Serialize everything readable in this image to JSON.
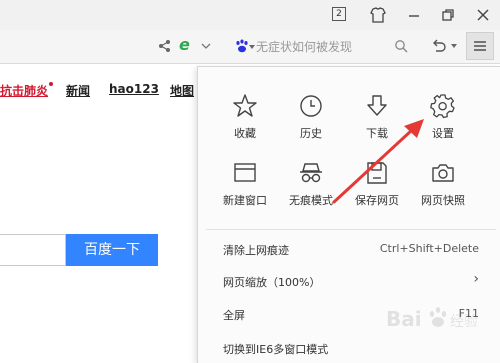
{
  "titlebar": {
    "tab_count": "2",
    "icons": [
      "shirt-icon",
      "minimize-icon",
      "restore-icon",
      "close-icon"
    ]
  },
  "toolbar": {
    "icons": [
      "share-icon",
      "ie-compat-icon",
      "chevron-down-icon",
      "baidu-paw-icon",
      "search-icon",
      "undo-icon",
      "menu-icon"
    ],
    "search_placeholder": "无症状如何被发现"
  },
  "page": {
    "nav_links": [
      "抗击肺炎",
      "新闻",
      "hao123",
      "地图"
    ],
    "search_button": "百度一下"
  },
  "menu": {
    "grid": [
      {
        "label": "收藏",
        "icon": "star-icon"
      },
      {
        "label": "历史",
        "icon": "clock-icon"
      },
      {
        "label": "下载",
        "icon": "download-icon"
      },
      {
        "label": "设置",
        "icon": "gear-icon"
      },
      {
        "label": "新建窗口",
        "icon": "new-window-icon"
      },
      {
        "label": "无痕模式",
        "icon": "incognito-icon"
      },
      {
        "label": "保存网页",
        "icon": "save-icon"
      },
      {
        "label": "网页快照",
        "icon": "camera-icon"
      }
    ],
    "rows": [
      {
        "label": "清除上网痕迹",
        "right": "Ctrl+Shift+Delete"
      },
      {
        "label": "网页缩放（100%）",
        "right": "›"
      },
      {
        "label": "全屏",
        "right": "F11"
      },
      {
        "label": "切换到IE6多窗口模式",
        "right": ""
      }
    ]
  },
  "annotation": {
    "color": "#e53935"
  },
  "colors": {
    "accent": "#3385ff",
    "nav_red": "#d2192f",
    "ie_green": "#2fa84f"
  }
}
